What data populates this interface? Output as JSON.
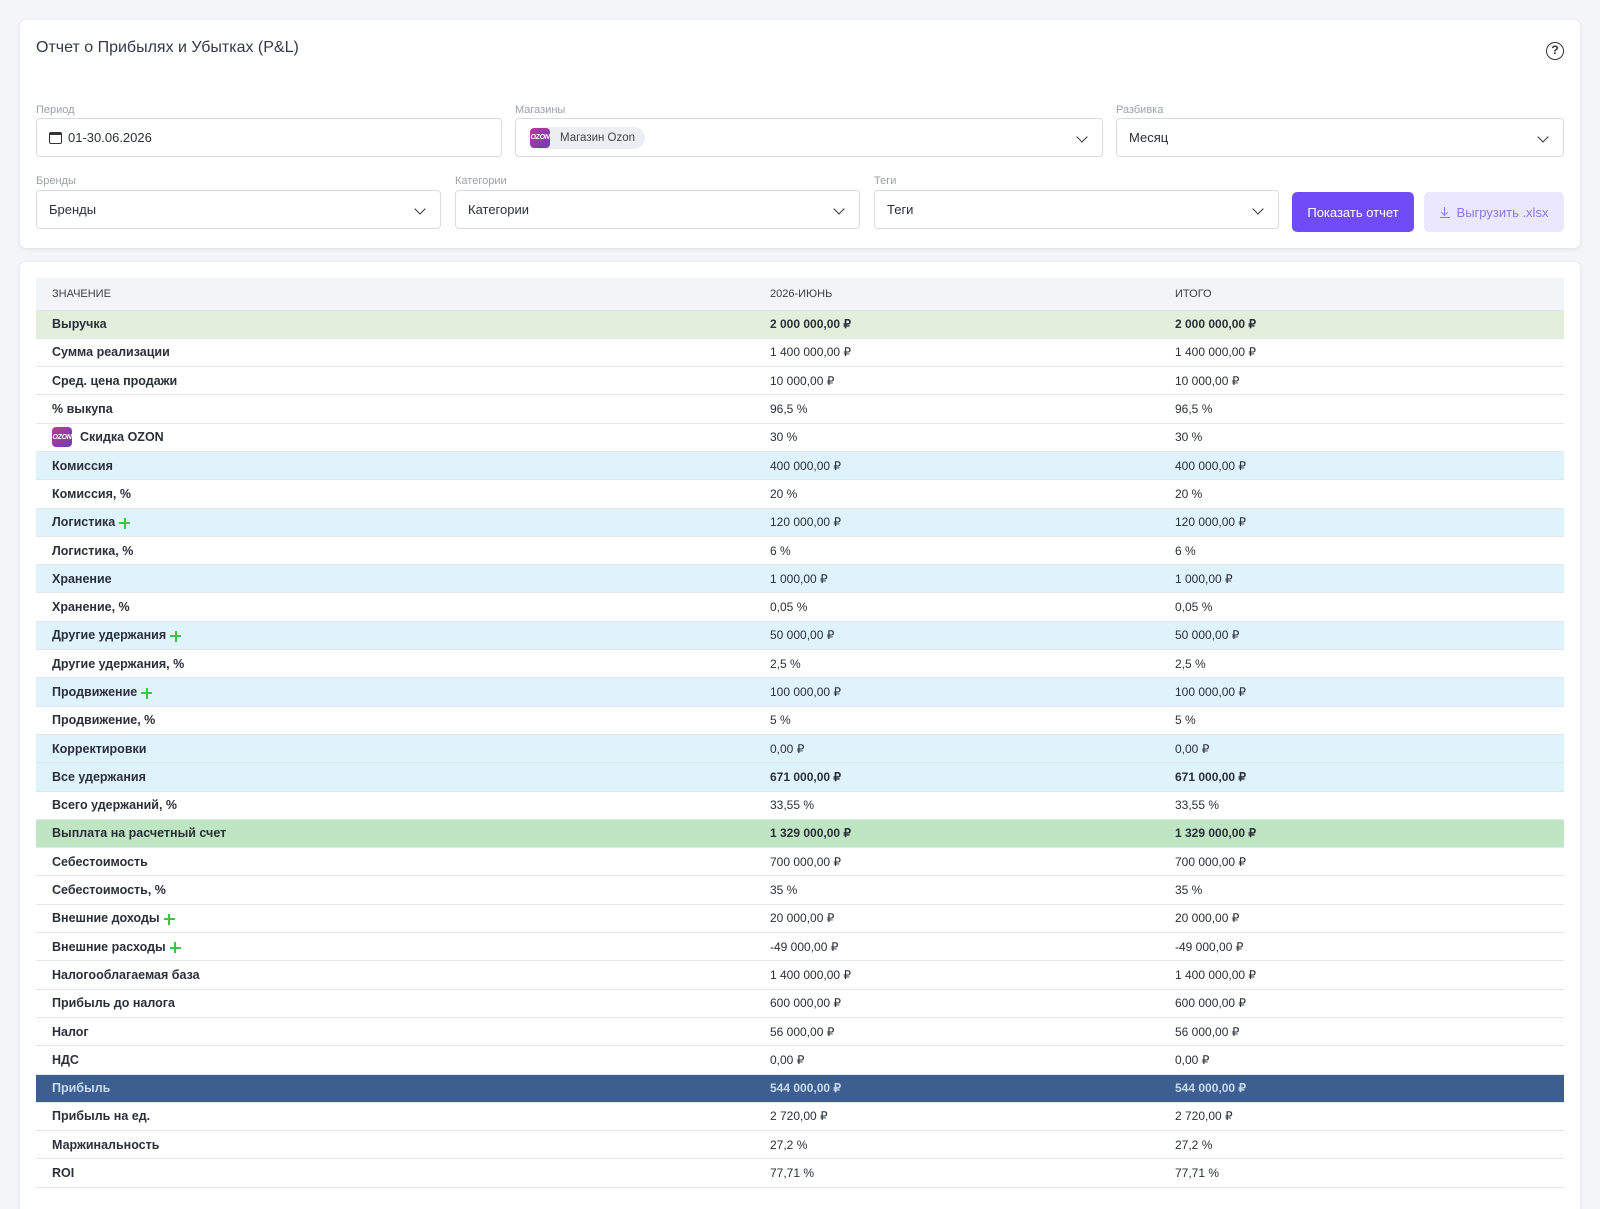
{
  "title": "Отчет о Прибылях и Убытках (P&L)",
  "help_icon_glyph": "?",
  "filters": {
    "period": {
      "label": "Период",
      "value": "01-30.06.2026"
    },
    "stores": {
      "label": "Магазины",
      "chip": "Магазин Ozon",
      "chip_logo": "OZON"
    },
    "breakdown": {
      "label": "Разбивка",
      "value": "Месяц"
    },
    "brands": {
      "label": "Бренды",
      "value": "Бренды"
    },
    "categories": {
      "label": "Категории",
      "value": "Категории"
    },
    "tags": {
      "label": "Теги",
      "value": "Теги"
    },
    "show_button": "Показать отчет",
    "export_button": "Выгрузить .xlsx"
  },
  "colors": {
    "accent": "#6f4cf5",
    "export_bg": "#ebe7fd",
    "green_row": "#e3efda",
    "payout_row": "#bfe5c3",
    "blue_row": "#dff3fc",
    "profit_row": "#3c5f8f",
    "plus": "#3cc445"
  },
  "table": {
    "headers": [
      "ЗНАЧЕНИЕ",
      "2026-ИЮНЬ",
      "ИТОГО"
    ],
    "rows": [
      {
        "label": "Выручка",
        "june": "2 000 000,00 ₽",
        "total": "2 000 000,00 ₽",
        "style": "green bold"
      },
      {
        "label": "Сумма реализации",
        "june": "1 400 000,00 ₽",
        "total": "1 400 000,00 ₽",
        "style": ""
      },
      {
        "label": "Сред. цена продажи",
        "june": "10 000,00 ₽",
        "total": "10 000,00 ₽",
        "style": ""
      },
      {
        "label": "% выкупа",
        "june": "96,5 %",
        "total": "96,5 %",
        "style": ""
      },
      {
        "label": "Скидка OZON",
        "june": "30 %",
        "total": "30 %",
        "style": "",
        "logo": true
      },
      {
        "label": "Комиссия",
        "june": "400 000,00 ₽",
        "total": "400 000,00 ₽",
        "style": "blue"
      },
      {
        "label": "Комиссия, %",
        "june": "20 %",
        "total": "20 %",
        "style": ""
      },
      {
        "label": "Логистика",
        "june": "120 000,00 ₽",
        "total": "120 000,00 ₽",
        "style": "blue",
        "plus": true
      },
      {
        "label": "Логистика, %",
        "june": "6 %",
        "total": "6 %",
        "style": ""
      },
      {
        "label": "Хранение",
        "june": "1 000,00 ₽",
        "total": "1 000,00 ₽",
        "style": "blue"
      },
      {
        "label": "Хранение, %",
        "june": "0,05 %",
        "total": "0,05 %",
        "style": ""
      },
      {
        "label": "Другие удержания",
        "june": "50 000,00 ₽",
        "total": "50 000,00 ₽",
        "style": "blue",
        "plus": true
      },
      {
        "label": "Другие удержания, %",
        "june": "2,5 %",
        "total": "2,5 %",
        "style": ""
      },
      {
        "label": "Продвижение",
        "june": "100 000,00 ₽",
        "total": "100 000,00 ₽",
        "style": "blue",
        "plus": true
      },
      {
        "label": "Продвижение, %",
        "june": "5 %",
        "total": "5 %",
        "style": ""
      },
      {
        "label": "Корректировки",
        "june": "0,00 ₽",
        "total": "0,00 ₽",
        "style": "blue"
      },
      {
        "label": "Все удержания",
        "june": "671 000,00 ₽",
        "total": "671 000,00 ₽",
        "style": "blue bold"
      },
      {
        "label": "Всего удержаний, %",
        "june": "33,55 %",
        "total": "33,55 %",
        "style": ""
      },
      {
        "label": "Выплата на расчетный счет",
        "june": "1 329 000,00 ₽",
        "total": "1 329 000,00 ₽",
        "style": "green2 bold"
      },
      {
        "label": "Себестоимость",
        "june": "700 000,00 ₽",
        "total": "700 000,00 ₽",
        "style": ""
      },
      {
        "label": "Себестоимость, %",
        "june": "35 %",
        "total": "35 %",
        "style": ""
      },
      {
        "label": "Внешние доходы",
        "june": "20 000,00 ₽",
        "total": "20 000,00 ₽",
        "style": "",
        "plus": true
      },
      {
        "label": "Внешние расходы",
        "june": "-49 000,00 ₽",
        "total": "-49 000,00 ₽",
        "style": "",
        "plus": true
      },
      {
        "label": "Налогооблагаемая база",
        "june": "1 400 000,00 ₽",
        "total": "1 400 000,00 ₽",
        "style": ""
      },
      {
        "label": "Прибыль до налога",
        "june": "600 000,00 ₽",
        "total": "600 000,00 ₽",
        "style": ""
      },
      {
        "label": "Налог",
        "june": "56 000,00 ₽",
        "total": "56 000,00 ₽",
        "style": ""
      },
      {
        "label": "НДС",
        "june": "0,00 ₽",
        "total": "0,00 ₽",
        "style": ""
      },
      {
        "label": "Прибыль",
        "june": "544 000,00 ₽",
        "total": "544 000,00 ₽",
        "style": "dark"
      },
      {
        "label": "Прибыль на ед.",
        "june": "2 720,00 ₽",
        "total": "2 720,00 ₽",
        "style": ""
      },
      {
        "label": "Маржинальность",
        "june": "27,2 %",
        "total": "27,2 %",
        "style": ""
      },
      {
        "label": "ROI",
        "june": "77,71 %",
        "total": "77,71 %",
        "style": ""
      }
    ]
  }
}
